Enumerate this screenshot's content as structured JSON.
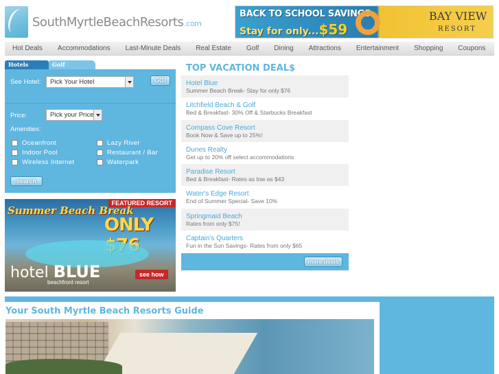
{
  "header": {
    "logo_main": "SouthMyrtleBeachResorts",
    "logo_suffix": ".com",
    "banner": {
      "headline": "BACK TO SCHOOL SAVINGS",
      "offer_prefix": "Stay for only...",
      "offer_price": "$59",
      "brand": "BAY VIEW",
      "brand_sub": "RESORT"
    }
  },
  "nav": [
    "Hot Deals",
    "Accommodations",
    "Last-Minute Deals",
    "Real Estate",
    "Golf",
    "Dining",
    "Attractions",
    "Entertainment",
    "Shopping",
    "Coupons"
  ],
  "search": {
    "tabs": [
      "Hotels",
      "Golf"
    ],
    "hotel_label": "See Hotel:",
    "hotel_select": "Pick Your Hotel",
    "go_label": "GO!",
    "price_label": "Price:",
    "price_select": "Pick your Price",
    "amenities_label": "Amenities:",
    "amenities": [
      "Oceanfront",
      "Lazy River",
      "Indoor Pool",
      "Restaurant / Bar",
      "Wireless Internet",
      "Waterpark"
    ],
    "search_label": "search"
  },
  "featured": {
    "tag": "FEATURED RESORT",
    "headline": "Summer Beach Break",
    "price": "ONLY $76",
    "brand_light": "hotel",
    "brand_bold": "BLUE",
    "brand_sub": "beachfront resort",
    "cta": "see how"
  },
  "deals": {
    "title": "TOP VACATION DEAL$",
    "items": [
      {
        "name": "Hotel Blue",
        "desc": "Summer Beach Break- Stay for only $76"
      },
      {
        "name": "Litchfield Beach & Golf",
        "desc": "Bed & Breakfast- 30% Off & Starbucks Breakfast"
      },
      {
        "name": "Compass Cove Resort",
        "desc": "Book Now & Save up to 25%!"
      },
      {
        "name": "Dunes Realty",
        "desc": "Get up to 20% off select accommodations"
      },
      {
        "name": "Paradise Resort",
        "desc": "Bed & Breakfast- Rates as low as $43"
      },
      {
        "name": "Water's Edge Resort",
        "desc": "End of Summer Special- Save 10%"
      },
      {
        "name": "Springmaid Beach",
        "desc": "Rates from only $75!"
      },
      {
        "name": "Captain's Quarters",
        "desc": "Fun in the Sun Savings- Rates from only $65"
      }
    ],
    "more_label": "more deals"
  },
  "guide": {
    "title": "Your South Myrtle Beach Resorts Guide"
  }
}
